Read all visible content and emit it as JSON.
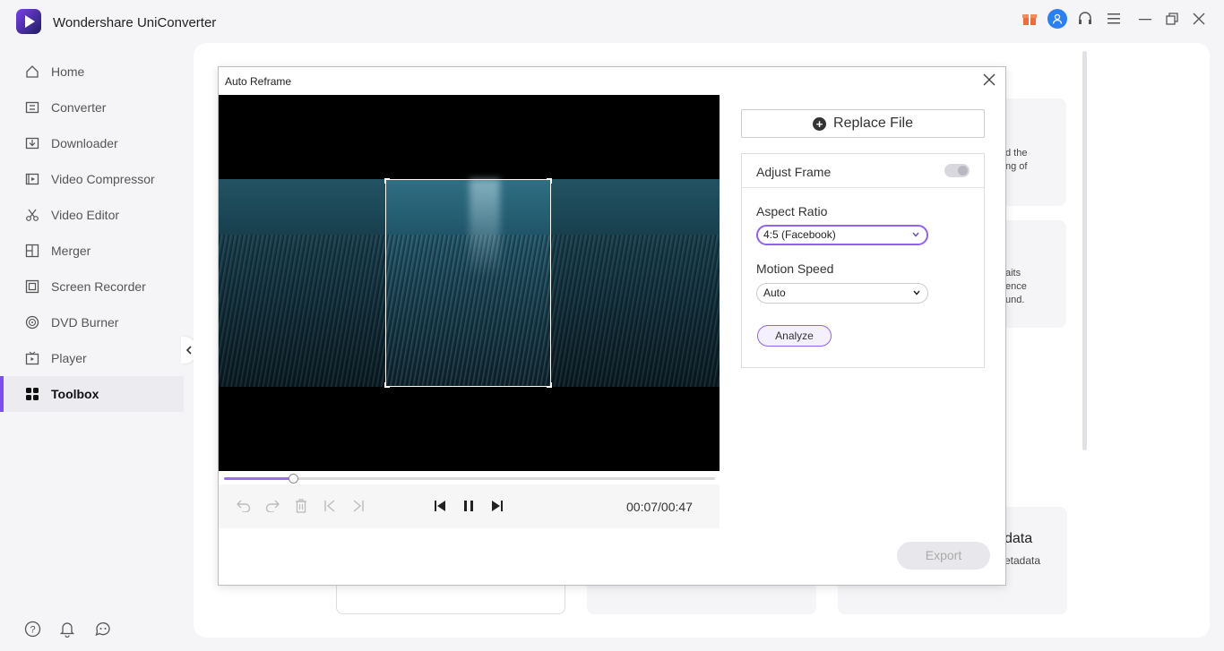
{
  "app": {
    "title": "Wondershare UniConverter"
  },
  "titlebar_icons": [
    "gift-icon",
    "user-avatar-icon",
    "headset-icon",
    "menu-icon",
    "minimize-icon",
    "restore-icon",
    "close-icon"
  ],
  "sidebar": {
    "items": [
      {
        "label": "Home",
        "icon": "home-icon"
      },
      {
        "label": "Converter",
        "icon": "converter-icon"
      },
      {
        "label": "Downloader",
        "icon": "download-icon"
      },
      {
        "label": "Video Compressor",
        "icon": "compress-icon"
      },
      {
        "label": "Video Editor",
        "icon": "scissors-icon"
      },
      {
        "label": "Merger",
        "icon": "merge-icon"
      },
      {
        "label": "Screen Recorder",
        "icon": "record-icon"
      },
      {
        "label": "DVD Burner",
        "icon": "disc-icon"
      },
      {
        "label": "Player",
        "icon": "player-icon"
      },
      {
        "label": "Toolbox",
        "icon": "grid-icon",
        "active": true
      }
    ],
    "bottom_icons": [
      "help-icon",
      "bell-icon",
      "feedback-icon"
    ]
  },
  "background": {
    "card1_text": "d the\nng of",
    "card2_text": "aits\nence\nund.",
    "card3_title": "data",
    "card3_text": "etadata"
  },
  "dialog": {
    "title": "Auto Reframe",
    "replace_label": "Replace File",
    "adjust_frame_label": "Adjust Frame",
    "aspect_ratio_label": "Aspect Ratio",
    "aspect_ratio_value": "4:5 (Facebook)",
    "motion_speed_label": "Motion Speed",
    "motion_speed_value": "Auto",
    "analyze_label": "Analyze",
    "export_label": "Export",
    "timecode": "00:07/00:47",
    "progress_fraction": 0.14
  },
  "colors": {
    "accent": "#8f63f0",
    "active_indicator": "#7a4df5"
  }
}
